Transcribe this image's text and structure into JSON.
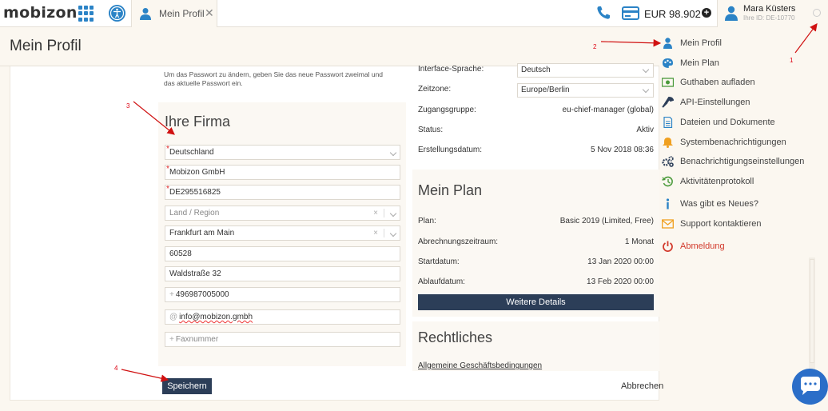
{
  "header": {
    "logo": "mobizon",
    "tab_label": "Mein Profil",
    "tab_close": "✕",
    "balance": "EUR 98.902",
    "add_funds": "+",
    "user_name": "Mara Küsters",
    "user_id": "Ihre ID: DE-10770"
  },
  "page": {
    "title": "Mein Profil"
  },
  "password_hint": "Um das Passwort zu ändern, geben Sie das neue Passwort zweimal und das aktuelle Passwort ein.",
  "company": {
    "title": "Ihre Firma",
    "country": "Deutschland",
    "name": "Mobizon GmbH",
    "vat": "DE295516825",
    "region_placeholder": "Land / Region",
    "city": "Frankfurt am Main",
    "zip": "60528",
    "street": "Waldstraße 32",
    "phone": "496987005000",
    "email": "info@mobizon.gmbh",
    "fax_placeholder": "Faxnummer",
    "phone_prefix": "+",
    "email_prefix": "@",
    "fax_prefix": "+",
    "clear": "×"
  },
  "actions": {
    "save": "Speichern",
    "cancel": "Abbrechen"
  },
  "account": {
    "language_label": "Interface-Sprache:",
    "language_value": "Deutsch",
    "timezone_label": "Zeitzone:",
    "timezone_value": "Europe/Berlin",
    "group_label": "Zugangsgruppe:",
    "group_value": "eu-chief-manager (global)",
    "status_label": "Status:",
    "status_value": "Aktiv",
    "created_label": "Erstellungsdatum:",
    "created_value": "5 Nov 2018 08:36"
  },
  "plan": {
    "title": "Mein Plan",
    "plan_label": "Plan:",
    "plan_value": "Basic 2019 (Limited, Free)",
    "period_label": "Abrechnungszeitraum:",
    "period_value": "1 Monat",
    "start_label": "Startdatum:",
    "start_value": "13 Jan 2020 00:00",
    "end_label": "Ablaufdatum:",
    "end_value": "13 Feb 2020 00:00",
    "details_button": "Weitere Details"
  },
  "legal": {
    "title": "Rechtliches",
    "terms_link": "Allgemeine Geschäftsbedingungen"
  },
  "menu": [
    {
      "label": "Mein Profil",
      "icon": "user-icon",
      "color": "#2b83c6"
    },
    {
      "label": "Mein Plan",
      "icon": "palette-icon",
      "color": "#2b83c6"
    },
    {
      "label": "Guthaben aufladen",
      "icon": "money-icon",
      "color": "#4a9a3a"
    },
    {
      "label": "API-Einstellungen",
      "icon": "wrench-icon",
      "color": "#2c3e58"
    },
    {
      "label": "Dateien und Dokumente",
      "icon": "document-icon",
      "color": "#2b83c6"
    },
    {
      "label": "Systembenachrichtigungen",
      "icon": "bell-icon",
      "color": "#f0a020"
    },
    {
      "label": "Benachrichtigungseinstellungen",
      "icon": "gears-icon",
      "color": "#2c3e58"
    },
    {
      "label": "Aktivitätenprotokoll",
      "icon": "history-icon",
      "color": "#4a9a3a"
    },
    {
      "label": "Was gibt es Neues?",
      "icon": "info-icon",
      "color": "#2b83c6"
    },
    {
      "label": "Support kontaktieren",
      "icon": "mail-icon",
      "color": "#f0a020"
    },
    {
      "label": "Abmeldung",
      "icon": "power-icon",
      "color": "#d23a2c"
    }
  ],
  "annotations": [
    "1",
    "2",
    "3",
    "4"
  ],
  "colors": {
    "accent": "#2b83c6",
    "dark_button": "#2c3e58",
    "danger": "#d23a2c",
    "annotation": "#d01111"
  }
}
